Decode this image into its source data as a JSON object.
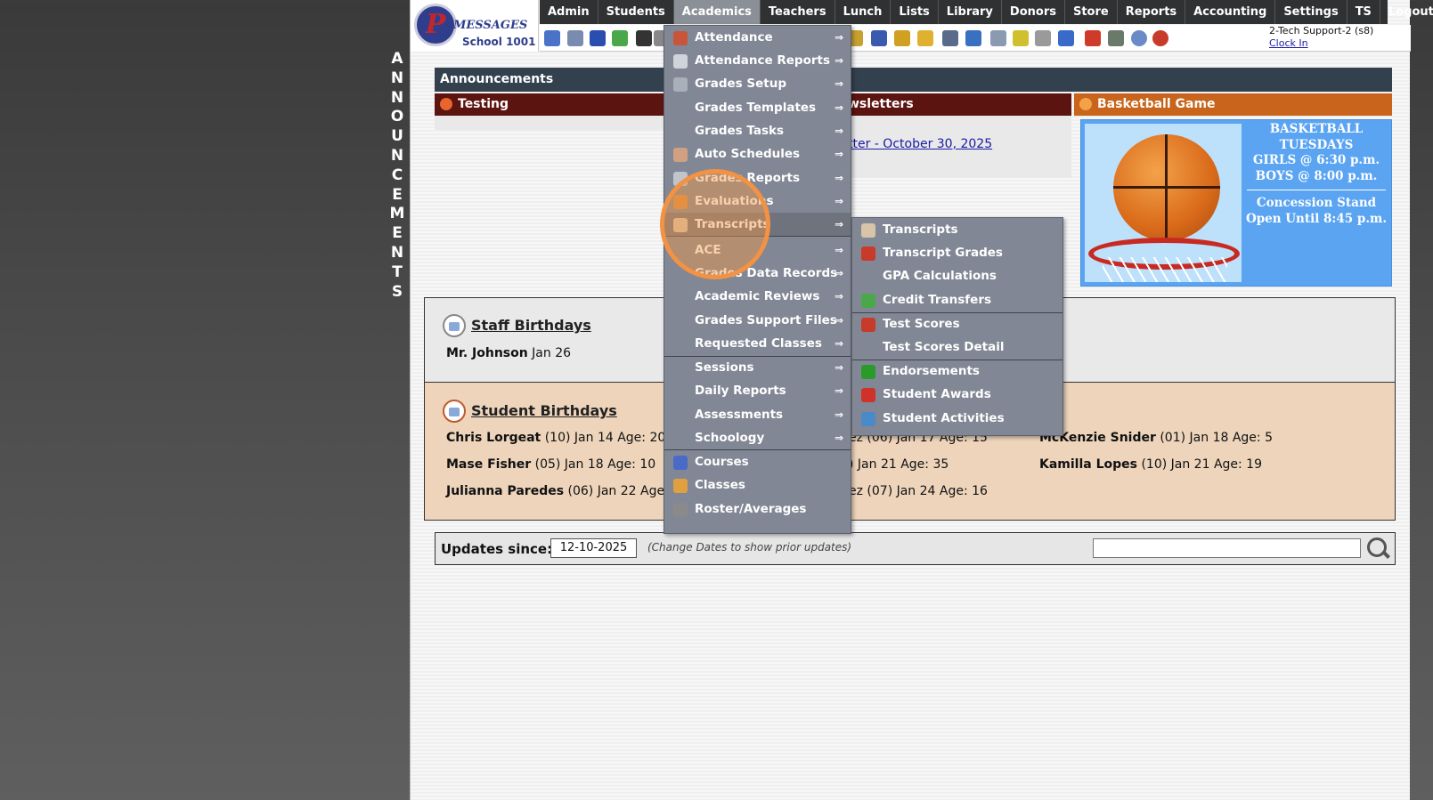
{
  "side_banner": "ANNOUNCEMENTS",
  "logo": {
    "letter": "P",
    "brand": "MESSAGES",
    "school": "School 1001"
  },
  "nav": {
    "items": [
      "Admin",
      "Students",
      "Academics",
      "Teachers",
      "Lunch",
      "Lists",
      "Library",
      "Donors",
      "Store",
      "Reports",
      "Accounting",
      "Settings",
      "TS",
      "Logout"
    ],
    "active": "Academics"
  },
  "user": {
    "name": "2-Tech Support-2 (s8)",
    "clock_in": "Clock In"
  },
  "announcements": {
    "header": "Announcements",
    "panels": [
      {
        "title": "Testing",
        "color": "#5c1410"
      },
      {
        "title": "Newsletters",
        "visible_title": "wsletters",
        "color": "#5c1410",
        "link": "tter - October 30, 2025"
      },
      {
        "title": "Basketball Game",
        "color": "#c8641c"
      }
    ],
    "basketball": {
      "lines": [
        "BASKETBALL",
        "TUESDAYS",
        "GIRLS @ 6:30 p.m.",
        "BOYS  @ 8:00 p.m."
      ],
      "lines2": [
        "Concession Stand",
        "Open Until 8:45 p.m."
      ]
    }
  },
  "staff_birthdays": {
    "title": "Staff Birthdays",
    "entries": [
      {
        "name": "Mr. Johnson",
        "date": "Jan 26"
      }
    ]
  },
  "student_birthdays": {
    "title": "Student Birthdays",
    "col1": [
      {
        "name": "Chris Lorgeat",
        "info": "(10) Jan 14 Age: 20"
      },
      {
        "name": "Mase Fisher",
        "info": "(05) Jan 18 Age: 10"
      },
      {
        "name": "Julianna Paredes",
        "info": "(06) Jan 22 Age:"
      }
    ],
    "col2": [
      "ez (06) Jan 17 Age: 15",
      ") Jan 21 Age: 35",
      "ez (07) Jan 24 Age: 16"
    ],
    "col3": [
      {
        "name": "McKenzie Snider",
        "info": "(01) Jan 18 Age: 5"
      },
      {
        "name": "Kamilla Lopes",
        "info": "(10) Jan 21 Age: 19"
      }
    ]
  },
  "updates": {
    "label": "Updates since:",
    "date": "12-10-2025",
    "hint": "(Change Dates to show prior updates)"
  },
  "academics_menu": {
    "items": [
      {
        "label": "Attendance",
        "icon": "calendar-icon",
        "arrow": "⇒"
      },
      {
        "label": "Attendance Reports",
        "icon": "printer-icon",
        "arrow": "⇒"
      },
      {
        "label": "Grades Setup",
        "icon": "gear-icon",
        "arrow": "⇒"
      },
      {
        "label": "Grades Templates",
        "icon": "",
        "arrow": "⇒"
      },
      {
        "label": "Grades Tasks",
        "icon": "",
        "arrow": "⇒"
      },
      {
        "label": "Auto Schedules",
        "icon": "schedule-icon",
        "arrow": "⇒"
      },
      {
        "label": "Grades Reports",
        "icon": "report-icon",
        "arrow": "⇒"
      },
      {
        "label": "Evaluations",
        "icon": "checkbox-icon",
        "arrow": "⇒"
      },
      {
        "label": "Transcripts",
        "icon": "document-icon",
        "arrow": "⇒"
      },
      {
        "label": "ACE",
        "icon": "",
        "arrow": "⇒"
      },
      {
        "label": "Grades Data Records",
        "icon": "",
        "arrow": "⇒"
      },
      {
        "label": "Academic Reviews",
        "icon": "",
        "arrow": "⇒"
      },
      {
        "label": "Grades Support Files",
        "icon": "",
        "arrow": "⇒"
      },
      {
        "label": "Requested Classes",
        "icon": "",
        "arrow": "⇒"
      },
      {
        "label": "Sessions",
        "icon": "",
        "arrow": "⇒"
      },
      {
        "label": "Daily Reports",
        "icon": "",
        "arrow": "⇒"
      },
      {
        "label": "Assessments",
        "icon": "",
        "arrow": "⇒"
      },
      {
        "label": "Schoology",
        "icon": "",
        "arrow": "⇒"
      },
      {
        "label": "Courses",
        "icon": "book-icon",
        "arrow": ""
      },
      {
        "label": "Classes",
        "icon": "person-icon",
        "arrow": ""
      },
      {
        "label": "Roster/Averages",
        "icon": "roster-icon",
        "arrow": ""
      }
    ]
  },
  "transcripts_submenu": {
    "items": [
      {
        "label": "Transcripts",
        "icon": "document-icon"
      },
      {
        "label": "Transcript Grades",
        "icon": "grade-a-plus-icon"
      },
      {
        "label": "GPA Calculations",
        "icon": ""
      },
      {
        "label": "Credit Transfers",
        "icon": "transfer-icon"
      },
      {
        "label": "Test Scores",
        "icon": "grade-a-plus-icon"
      },
      {
        "label": "Test Scores Detail",
        "icon": ""
      },
      {
        "label": "Endorsements",
        "icon": "checkmark-icon"
      },
      {
        "label": "Student Awards",
        "icon": "award-icon"
      },
      {
        "label": "Student Activities",
        "icon": "activity-icon"
      }
    ]
  },
  "colors": {
    "navbar": "#2f3133",
    "menu": "#818794",
    "highlight": "#f29244",
    "panel_header_dark": "#5c1410",
    "panel_header_orange": "#c8641c"
  }
}
